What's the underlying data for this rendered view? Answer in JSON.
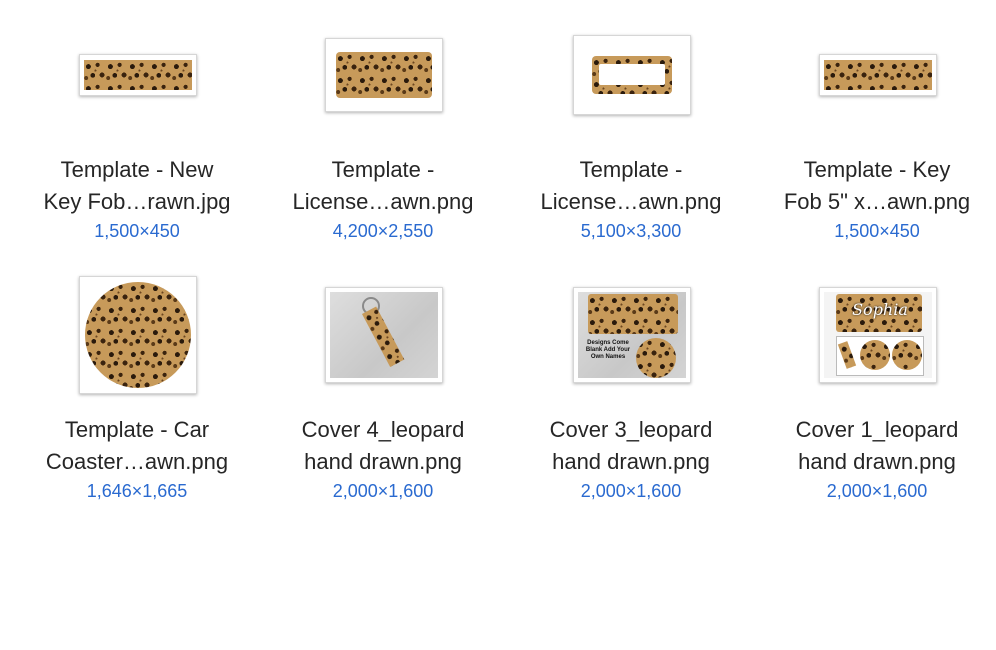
{
  "files": [
    {
      "name_line1": "Template - New",
      "name_line2": "Key Fob…rawn.jpg",
      "dimensions": "1,500×450",
      "thumb_icon": "key-fob-leopard-thumbnail"
    },
    {
      "name_line1": "Template -",
      "name_line2": "License…awn.png",
      "dimensions": "4,200×2,550",
      "thumb_icon": "license-plate-leopard-thumbnail"
    },
    {
      "name_line1": "Template -",
      "name_line2": "License…awn.png",
      "dimensions": "5,100×3,300",
      "thumb_icon": "license-frame-leopard-thumbnail"
    },
    {
      "name_line1": "Template - Key",
      "name_line2": "Fob 5\" x…awn.png",
      "dimensions": "1,500×450",
      "thumb_icon": "key-fob-leopard-thumbnail"
    },
    {
      "name_line1": "Template - Car",
      "name_line2": "Coaster…awn.png",
      "dimensions": "1,646×1,665",
      "thumb_icon": "car-coaster-leopard-thumbnail"
    },
    {
      "name_line1": "Cover 4_leopard",
      "name_line2": "hand drawn.png",
      "dimensions": "2,000×1,600",
      "thumb_icon": "keychain-cover-thumbnail"
    },
    {
      "name_line1": "Cover 3_leopard",
      "name_line2": "hand drawn.png",
      "dimensions": "2,000×1,600",
      "thumb_icon": "designs-cover-thumbnail",
      "thumb_text": "Designs Come Blank Add Your Own Names"
    },
    {
      "name_line1": "Cover 1_leopard",
      "name_line2": "hand drawn.png",
      "dimensions": "2,000×1,600",
      "thumb_icon": "sophia-cover-thumbnail",
      "thumb_text": "Sophia"
    }
  ]
}
